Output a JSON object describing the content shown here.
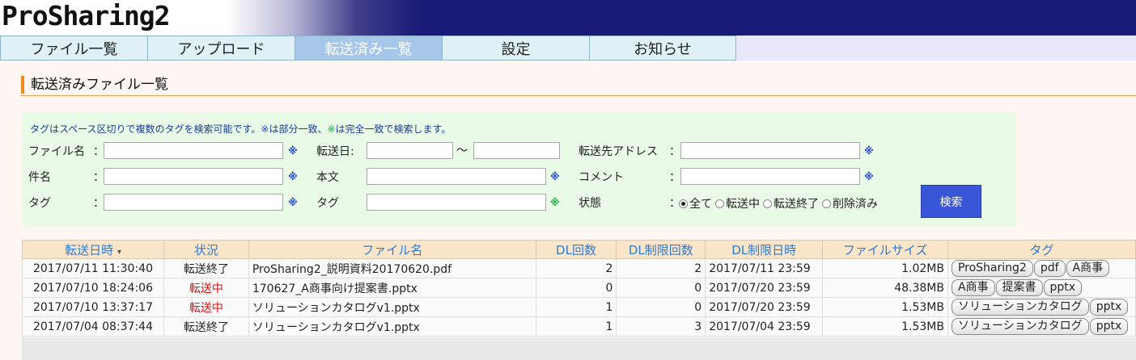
{
  "app": {
    "logo": "ProSharing2"
  },
  "nav": [
    {
      "label": "ファイル一覧",
      "active": false
    },
    {
      "label": "アップロード",
      "active": false
    },
    {
      "label": "転送済み一覧",
      "active": true
    },
    {
      "label": "設定",
      "active": false
    },
    {
      "label": "お知らせ",
      "active": false
    }
  ],
  "page": {
    "title": "転送済みファイル一覧"
  },
  "search": {
    "hint_prefix": "タグはスペース区切りで複数のタグを検索可能です。",
    "hint_mark1": "※",
    "hint_mid": "は部分一致、",
    "hint_mark2": "※",
    "hint_suffix": "は完全一致で検索します。",
    "mark": "※",
    "labels": {
      "filename": "ファイル名",
      "subject": "件名",
      "tag1": "タグ",
      "transfer_date": "転送日:",
      "body": "本文",
      "tag2": "タグ",
      "dest": "転送先アドレス",
      "comment": "コメント",
      "status": "状態"
    },
    "colon": "：",
    "tilde": "～",
    "status_options": [
      "全て",
      "転送中",
      "転送終了",
      "削除済み"
    ],
    "status_selected": "全て",
    "button": "検索"
  },
  "table": {
    "headers": [
      "転送日時",
      "状況",
      "ファイル名",
      "DL回数",
      "DL制限回数",
      "DL制限日時",
      "ファイルサイズ",
      "タグ"
    ],
    "sort_icon": "▾",
    "rows": [
      {
        "datetime": "2017/07/11 11:30:40",
        "status": "転送終了",
        "status_color": "#222222",
        "filename": "ProSharing2_説明資料20170620.pdf",
        "dl": "2",
        "dl_limit": "2",
        "dl_limit_date": "2017/07/11 23:59",
        "size": "1.02MB",
        "tags": [
          "ProSharing2",
          "pdf",
          "A商事"
        ]
      },
      {
        "datetime": "2017/07/10 18:24:06",
        "status": "転送中",
        "status_color": "#e01010",
        "filename": "170627_A商事向け提案書.pptx",
        "dl": "0",
        "dl_limit": "0",
        "dl_limit_date": "2017/07/20 23:59",
        "size": "48.38MB",
        "tags": [
          "A商事",
          "提案書",
          "pptx"
        ]
      },
      {
        "datetime": "2017/07/10 13:37:17",
        "status": "転送中",
        "status_color": "#e01010",
        "filename": "ソリューションカタログv1.pptx",
        "dl": "1",
        "dl_limit": "0",
        "dl_limit_date": "2017/07/20 23:59",
        "size": "1.53MB",
        "tags": [
          "ソリューションカタログ",
          "pptx"
        ]
      },
      {
        "datetime": "2017/07/04 08:37:44",
        "status": "転送終了",
        "status_color": "#222222",
        "filename": "ソリューションカタログv1.pptx",
        "dl": "1",
        "dl_limit": "3",
        "dl_limit_date": "2017/07/04 23:59",
        "size": "1.53MB",
        "tags": [
          "ソリューションカタログ",
          "pptx"
        ]
      }
    ]
  }
}
